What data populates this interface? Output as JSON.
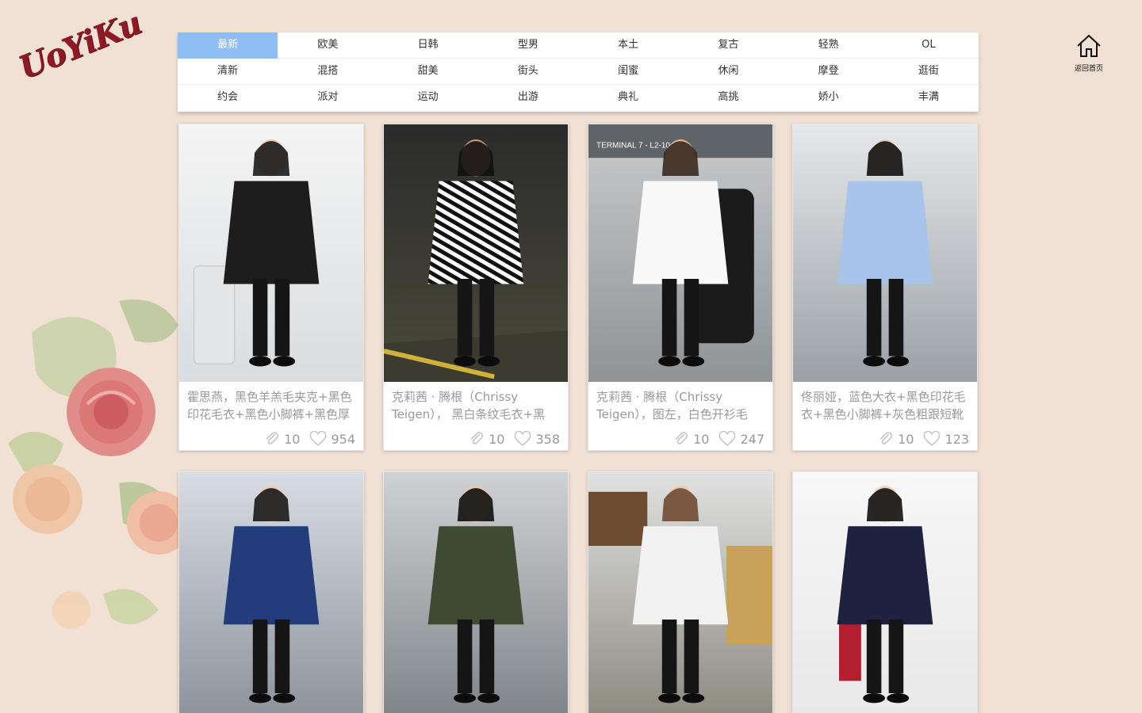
{
  "logo": {
    "text": "UoYiKu"
  },
  "home": {
    "label": "返回首页",
    "icon": "house-icon"
  },
  "categories": {
    "rows": [
      [
        "最新",
        "欧美",
        "日韩",
        "型男",
        "本土",
        "复古",
        "轻熟",
        "OL"
      ],
      [
        "清新",
        "混搭",
        "甜美",
        "街头",
        "闺蜜",
        "休闲",
        "摩登",
        "逛街"
      ],
      [
        "约会",
        "派对",
        "运动",
        "出游",
        "典礼",
        "高挑",
        "娇小",
        "丰满"
      ]
    ],
    "active": "最新",
    "active_color": "#8fbef5"
  },
  "cards": [
    {
      "title": "霍思燕，黑色羊羔毛夹克+黑色印花毛衣+黑色小脚裤+黑色厚",
      "clips": "10",
      "likes": "954"
    },
    {
      "title": "克莉茜 · 腾根（Chrissy Teigen）， 黑白条纹毛衣+黑",
      "clips": "10",
      "likes": "358"
    },
    {
      "title": "克莉茜 · 腾根（Chrissy Teigen），图左，白色开衫毛",
      "clips": "10",
      "likes": "247"
    },
    {
      "title": "佟丽娅，蓝色大衣+黑色印花毛衣+黑色小脚裤+灰色粗跟短靴",
      "clips": "10",
      "likes": "123"
    },
    {
      "title": "",
      "clips": "",
      "likes": ""
    },
    {
      "title": "",
      "clips": "",
      "likes": ""
    },
    {
      "title": "",
      "clips": "",
      "likes": ""
    },
    {
      "title": "",
      "clips": "",
      "likes": ""
    }
  ],
  "colors": {
    "background": "#f1e1d5",
    "logo": "#8e1a26",
    "meta_text": "#9a9a9a"
  }
}
